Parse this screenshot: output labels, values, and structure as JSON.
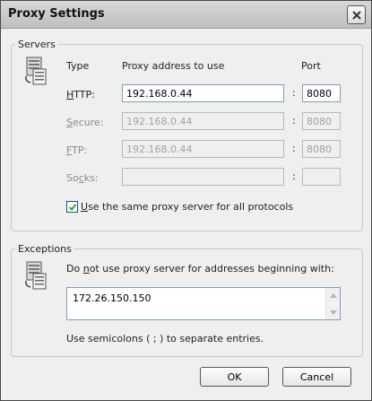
{
  "window": {
    "title": "Proxy Settings"
  },
  "servers": {
    "legend": "Servers",
    "col_type": "Type",
    "col_address": "Proxy address to use",
    "col_port": "Port",
    "rows": [
      {
        "label_u": "H",
        "label_rest": "TTP:",
        "address": "192.168.0.44",
        "port": "8080",
        "enabled": true
      },
      {
        "label_u": "S",
        "label_rest": "ecure:",
        "address": "192.168.0.44",
        "port": "8080",
        "enabled": false
      },
      {
        "label_u": "F",
        "label_rest": "TP:",
        "address": "192.168.0.44",
        "port": "8080",
        "enabled": false
      },
      {
        "label_pre": "So",
        "label_u": "c",
        "label_rest": "ks:",
        "address": "",
        "port": "",
        "enabled": false
      }
    ],
    "colon": ":",
    "same_proxy": {
      "label_u": "U",
      "label_rest": "se the same proxy server for all protocols",
      "checked": true
    }
  },
  "exceptions": {
    "legend": "Exceptions",
    "prompt_pre": "Do ",
    "prompt_u": "n",
    "prompt_rest": "ot use proxy server for addresses beginning with:",
    "value": "172.26.150.150",
    "hint": "Use semicolons ( ; ) to separate entries."
  },
  "buttons": {
    "ok": "OK",
    "cancel": "Cancel"
  },
  "icons": {
    "close": "close-icon",
    "server": "server-icon",
    "check": "check-icon",
    "scroll_up": "arrow-up-icon",
    "scroll_down": "arrow-down-icon"
  }
}
